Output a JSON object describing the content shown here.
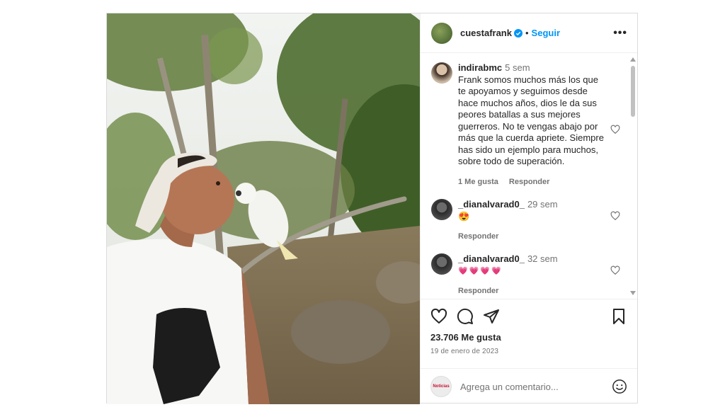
{
  "header": {
    "username": "cuestafrank",
    "separator": "•",
    "follow_label": "Seguir",
    "more_icon": "more-horizontal-icon",
    "more_label": "•••"
  },
  "comments": [
    {
      "username": "indirabmc",
      "time": "5 sem",
      "text": "Frank somos muchos más los que te apoyamos y seguimos desde hace muchos años, dios le da sus peores batallas a sus mejores guerreros. No te vengas abajo por más que la cuerda apriete. Siempre has sido un ejemplo para muchos, sobre todo de superación.",
      "likes": "1 Me gusta",
      "reply": "Responder"
    },
    {
      "username": "_dianalvarad0_",
      "time": "29 sem",
      "text": "😍",
      "reply": "Responder"
    },
    {
      "username": "_dianalvarad0_",
      "time": "32 sem",
      "text": "💗💗💗💗",
      "reply": "Responder"
    }
  ],
  "actions": {
    "icons": [
      "heart-icon",
      "comment-icon",
      "share-icon",
      "bookmark-icon"
    ],
    "likes": "23.706 Me gusta",
    "date": "19 de enero de 2023"
  },
  "composer": {
    "placeholder": "Agrega un comentario...",
    "avatar_text": "Noticias",
    "emoji_icon": "smiley-icon"
  },
  "colors": {
    "accent": "#0095f6",
    "border": "#dbdbdb",
    "muted": "#737373"
  }
}
